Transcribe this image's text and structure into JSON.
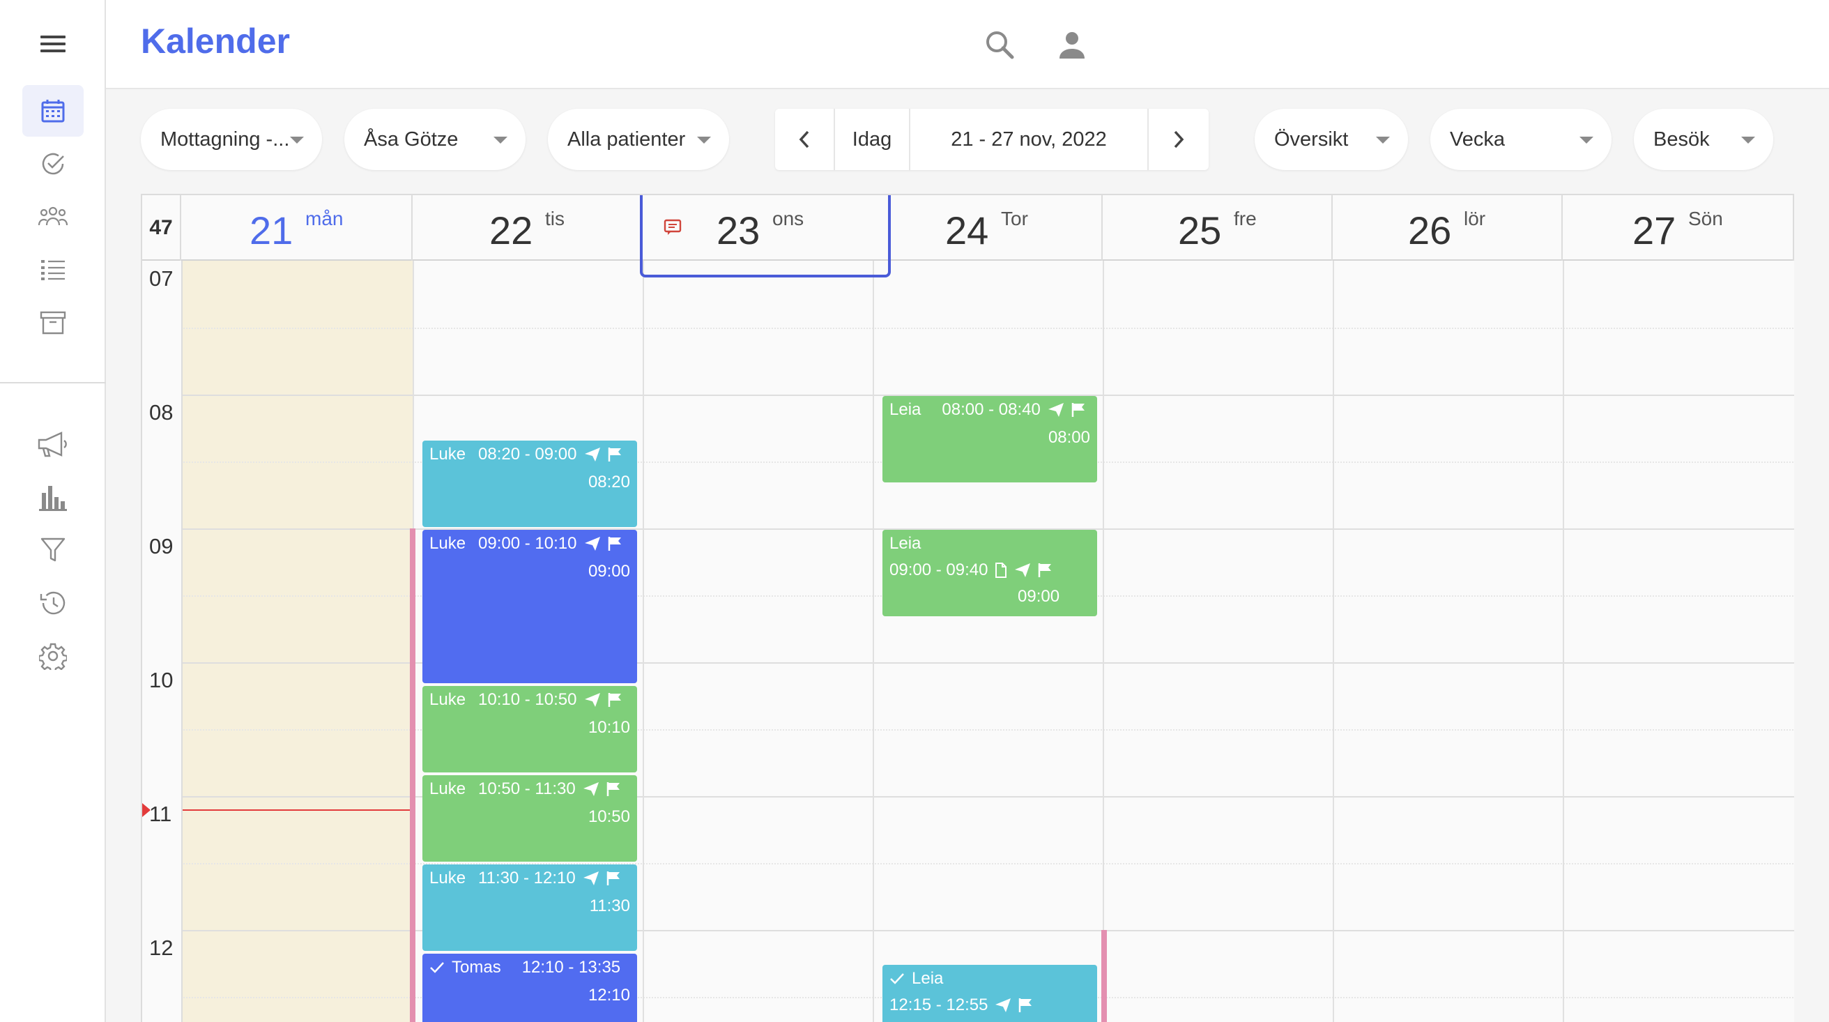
{
  "app": {
    "title": "Kalender"
  },
  "sidebar": {
    "items": [
      {
        "icon": "calendar-icon",
        "active": true
      },
      {
        "icon": "check-circle-icon",
        "active": false
      },
      {
        "icon": "group-icon",
        "active": false
      },
      {
        "icon": "list-icon",
        "active": false
      },
      {
        "icon": "archive-icon",
        "active": false
      },
      {
        "icon": "megaphone-icon",
        "active": false
      },
      {
        "icon": "bar-chart-icon",
        "active": false
      },
      {
        "icon": "filter-icon",
        "active": false
      },
      {
        "icon": "history-icon",
        "active": false
      },
      {
        "icon": "settings-icon",
        "active": false
      }
    ]
  },
  "toolbar": {
    "reception": "Mottagning -...",
    "staff": "Åsa Götze",
    "patients": "Alla patienter",
    "today_label": "Idag",
    "date_range": "21 - 27 nov, 2022",
    "overview": "Översikt",
    "period": "Vecka",
    "type": "Besök"
  },
  "calendar": {
    "week_number": "47",
    "days": [
      {
        "num": "21",
        "name": "mån"
      },
      {
        "num": "22",
        "name": "tis"
      },
      {
        "num": "23",
        "name": "ons"
      },
      {
        "num": "24",
        "name": "Tor"
      },
      {
        "num": "25",
        "name": "fre"
      },
      {
        "num": "26",
        "name": "lör"
      },
      {
        "num": "27",
        "name": "Sön"
      }
    ],
    "hours": [
      "07",
      "08",
      "09",
      "10",
      "11",
      "12"
    ],
    "events": {
      "e1": {
        "name": "Luke",
        "time": "08:20 - 09:00",
        "start": "08:20"
      },
      "e2": {
        "name": "Luke",
        "time": "09:00 - 10:10",
        "start": "09:00"
      },
      "e3": {
        "name": "Luke",
        "time": "10:10 - 10:50",
        "start": "10:10"
      },
      "e4": {
        "name": "Luke",
        "time": "10:50 - 11:30",
        "start": "10:50"
      },
      "e5": {
        "name": "Luke",
        "time": "11:30 - 12:10",
        "start": "11:30"
      },
      "e6": {
        "name": "Tomas",
        "time": "12:10 - 13:35",
        "start": "12:10"
      },
      "e7": {
        "name": "Leia",
        "time": "08:00 - 08:40",
        "start": "08:00"
      },
      "e8": {
        "name": "Leia",
        "time": "09:00 - 09:40",
        "start": "09:00"
      },
      "e9": {
        "name": "Leia",
        "time": "12:15 - 12:55",
        "start": ""
      }
    }
  },
  "colors": {
    "accent": "#4f6cea",
    "event_blue": "#5bc3d9",
    "event_indigo": "#516cf0",
    "event_green": "#7fcf7a",
    "monday_bg": "#f6f0dc",
    "now_line": "#e23b3b"
  }
}
